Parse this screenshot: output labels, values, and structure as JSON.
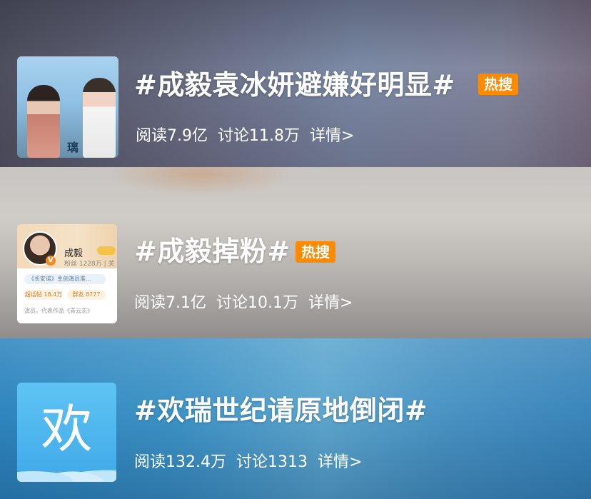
{
  "topics": [
    {
      "title": "#成毅袁冰妍避嫌好明显#",
      "badge": "热搜",
      "read_label": "阅读7.9亿",
      "discuss_label": "讨论11.8万",
      "detail_label": "详情>",
      "thumb": {
        "banner_text": "璃"
      }
    },
    {
      "title": "#成毅掉粉#",
      "badge": "热搜",
      "read_label": "阅读7.1亿",
      "discuss_label": "讨论10.1万",
      "detail_label": "详情>",
      "thumb": {
        "name": "成毅",
        "verified": "V",
        "fans": "粉丝 1228万 | 关",
        "pill": "《长安诺》主创演员准...",
        "stat1": "超话帖 18.4万",
        "stat2": "群友 8777",
        "desc": "演员，代表作品《青云志》"
      }
    },
    {
      "title": "#欢瑞世纪请原地倒闭#",
      "badge": "",
      "read_label": "阅读132.4万",
      "discuss_label": "讨论1313",
      "detail_label": "详情>",
      "thumb": {
        "glyph": "欢"
      }
    }
  ],
  "colors": {
    "badge": "#ff8a00",
    "text": "#ffffff"
  }
}
